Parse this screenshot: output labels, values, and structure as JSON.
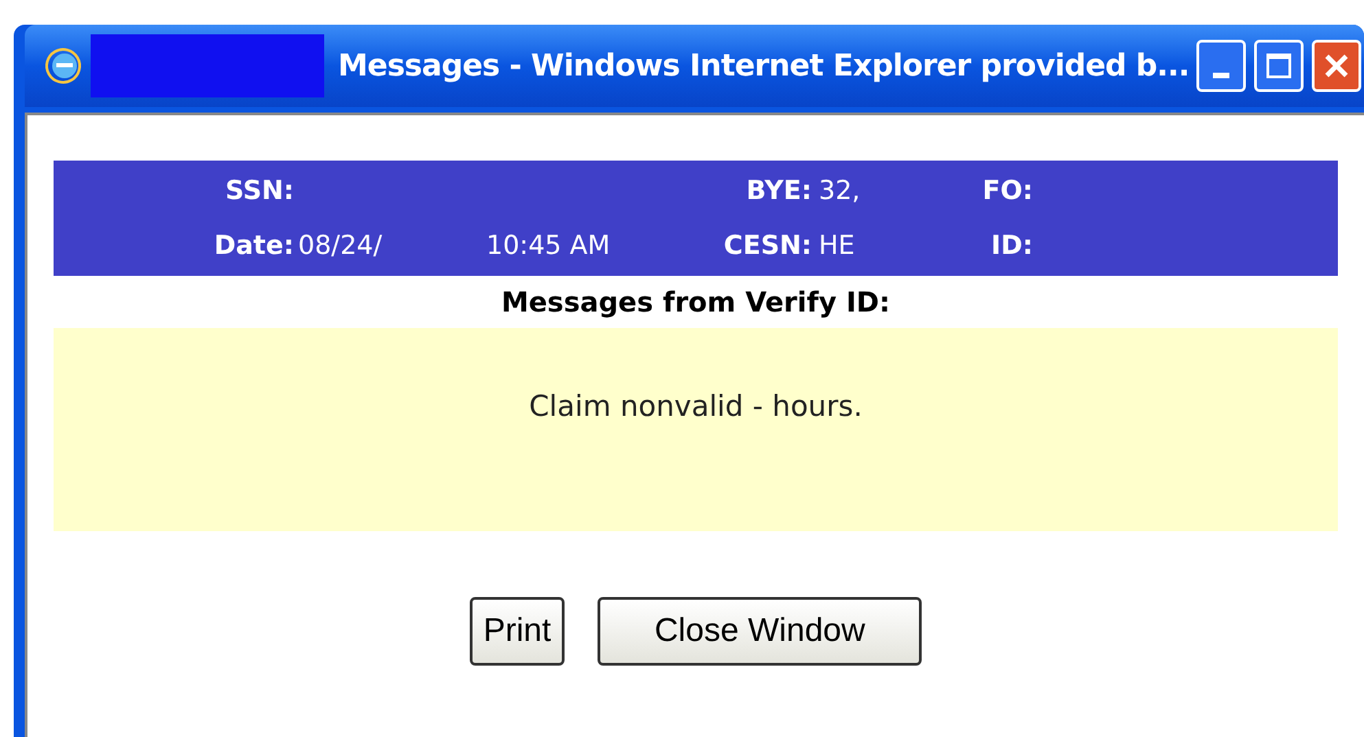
{
  "window": {
    "title": "Messages - Windows Internet Explorer provided b..."
  },
  "header": {
    "rows": [
      {
        "cells": [
          {
            "label": "SSN:"
          },
          {},
          {
            "label": "BYE:",
            "value": "32,"
          },
          {
            "label": "FO:"
          }
        ]
      },
      {
        "cells": [
          {
            "label": "Date:",
            "value": "08/24/"
          },
          {
            "time": "10:45 AM"
          },
          {
            "label": "CESN:",
            "value": "HE"
          },
          {
            "label": "ID:"
          }
        ]
      }
    ]
  },
  "section_title": "Messages from Verify ID:",
  "message": "Claim nonvalid - hours.",
  "buttons": [
    "Print",
    "Close Window"
  ]
}
